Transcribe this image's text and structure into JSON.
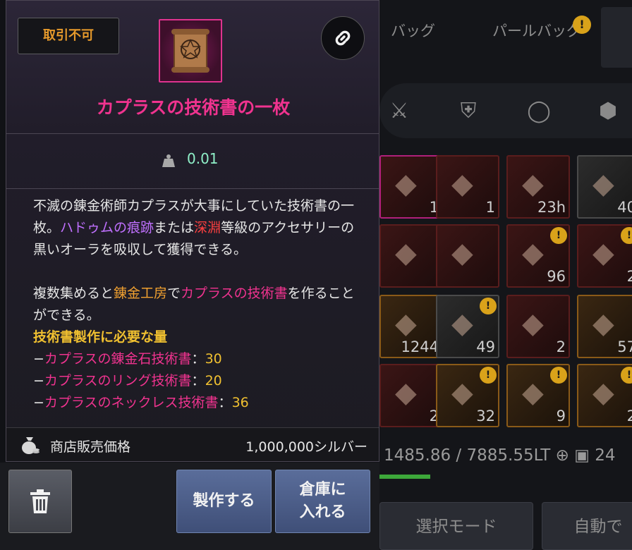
{
  "background": {
    "tabs": [
      {
        "label": "バッグ"
      },
      {
        "label": "パールバッグ"
      }
    ],
    "tab_badge": "!",
    "categories": [
      "swords-icon",
      "armor-icon",
      "ring-icon",
      "gem-icon"
    ],
    "slots": [
      {
        "count": "1",
        "badge": "",
        "style": "pink"
      },
      {
        "count": "1",
        "badge": "",
        "style": "red"
      },
      {
        "count": "23h",
        "badge": "",
        "style": "red"
      },
      {
        "count": "40",
        "badge": "",
        "style": "gray"
      },
      {
        "count": "",
        "badge": "",
        "style": "red"
      },
      {
        "count": "",
        "badge": "",
        "style": "red"
      },
      {
        "count": "96",
        "badge": "!",
        "style": "red"
      },
      {
        "count": "2",
        "badge": "!",
        "style": "red"
      },
      {
        "count": "1244",
        "badge": "",
        "style": "gold"
      },
      {
        "count": "49",
        "badge": "!",
        "style": "gray"
      },
      {
        "count": "2",
        "badge": "",
        "style": "red"
      },
      {
        "count": "57",
        "badge": "",
        "style": "gold"
      },
      {
        "count": "2",
        "badge": "",
        "style": "red"
      },
      {
        "count": "32",
        "badge": "!",
        "style": "gold"
      },
      {
        "count": "9",
        "badge": "!",
        "style": "gold"
      },
      {
        "count": "2",
        "badge": "!",
        "style": "gold"
      }
    ],
    "weight_text": "1485.86 / 7885.55LT",
    "weight_extra": "24",
    "buttons": [
      "選択モード",
      "自動で"
    ]
  },
  "tooltip": {
    "trade_badge": "取引不可",
    "item_icon": "scroll-icon",
    "link_icon": "link-icon",
    "item_name": "カプラスの技術書の一枚",
    "weight_value": "0.01",
    "desc1": {
      "a": "不滅の錬金術師カプラスが大事にしていた技術書の一枚。",
      "b": "ハドゥムの痕跡",
      "c": "または",
      "d": "深淵",
      "e": "等級のアクセサリーの黒いオーラを吸収して獲得できる。"
    },
    "desc2": {
      "a": "複数集めると",
      "b": "錬金工房",
      "c": "で",
      "d": "カプラスの技術書",
      "e": "を作ることができる。"
    },
    "req_title": "技術書製作に必要な量",
    "requirements": [
      {
        "prefix": "−",
        "name": "カプラスの錬金石技術書",
        "sep": "：",
        "qty": "30"
      },
      {
        "prefix": "−",
        "name": "カプラスのリング技術書",
        "sep": "：",
        "qty": "20"
      },
      {
        "prefix": "−",
        "name": "カプラスのネックレス技術書",
        "sep": "：",
        "qty": "36"
      }
    ],
    "sell_label": "商店販売価格",
    "sell_value": "1,000,000シルバー"
  },
  "actions": {
    "trash_icon": "trash-icon",
    "craft_label": "製作する",
    "store_label_1": "倉庫に",
    "store_label_2": "入れる"
  },
  "colors": {
    "item_name": "#f0338f",
    "trade_badge": "#e79a2b",
    "weight": "#8ff0c8",
    "highlight_purple": "#c070ff",
    "highlight_red": "#ff4040",
    "highlight_orange": "#f0a030",
    "highlight_gold": "#f0c030",
    "button_blue": "#4f6290"
  }
}
